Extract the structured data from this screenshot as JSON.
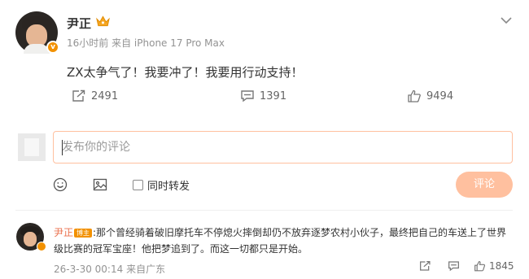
{
  "post": {
    "username": "尹正",
    "time": "16小时前",
    "source": "来自 iPhone 17 Pro Max",
    "content": "ZX太争气了！我要冲了！我要用行动支持！",
    "repost_count": "2491",
    "comment_count": "1391",
    "like_count": "9494",
    "verified_badge": "v"
  },
  "composer": {
    "placeholder": "发布你的评论",
    "forward_label": "同时转发",
    "submit_label": "评论"
  },
  "comment": {
    "author": "尹正",
    "author_tag": "博主",
    "text": ":那个曾经骑着破旧摩托车不停熄火摔倒却仍不放弃逐梦农村小伙子，最终把自己的车送上了世界级比赛的冠军宝座！他把梦追到了。而这一切都只是开始。",
    "time": "26-3-30 00:14",
    "location": "来自广东",
    "like_count": "1845"
  },
  "colors": {
    "accent_orange": "#f29100",
    "button_disabled": "#ffc09f",
    "author_link": "#eb7350",
    "muted_text": "#939393"
  },
  "icons": [
    "crown-icon",
    "chevron-down-icon",
    "repost-icon",
    "comment-icon",
    "like-icon",
    "emoji-icon",
    "image-icon"
  ]
}
